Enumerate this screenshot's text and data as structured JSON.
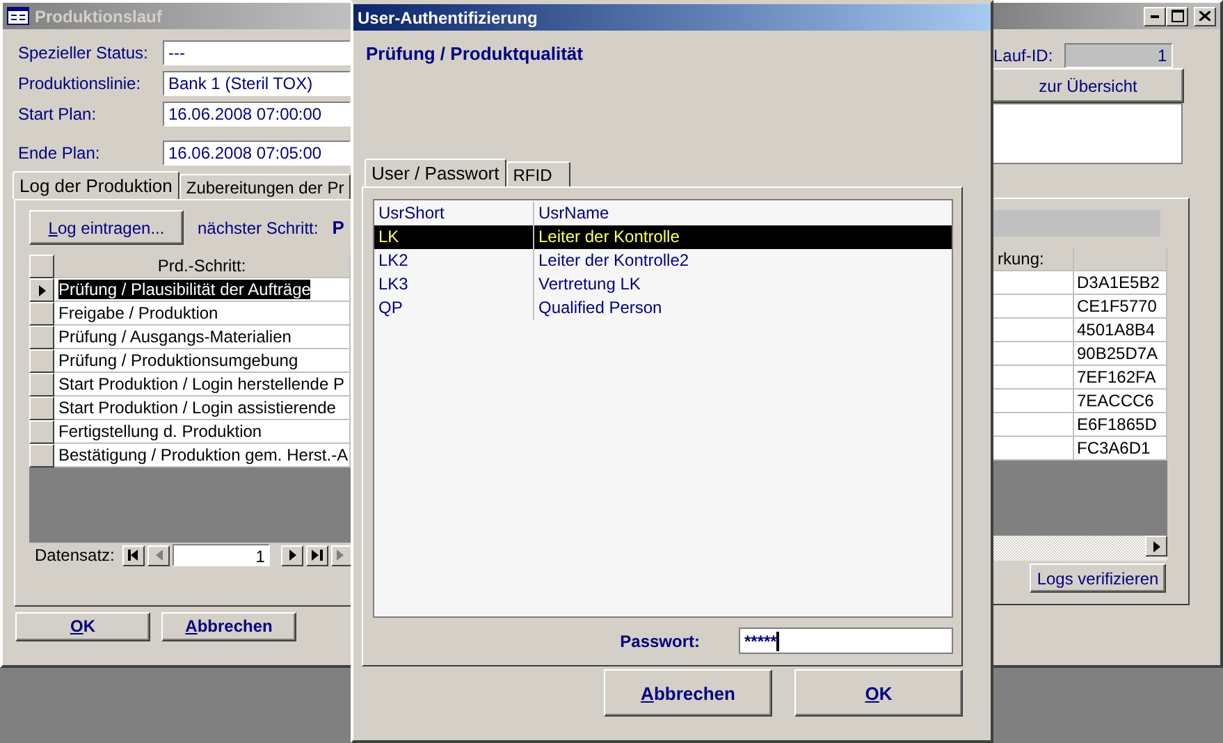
{
  "main_window": {
    "title": "Produktionslauf",
    "fields": [
      {
        "label": "Spezieller Status:",
        "value": "---"
      },
      {
        "label": "Produktionslinie:",
        "value": "Bank 1 (Steril TOX)"
      },
      {
        "label": "Start Plan:",
        "value": "16.06.2008 07:00:00"
      },
      {
        "label": "Ende Plan:",
        "value": "16.06.2008 07:05:00"
      }
    ],
    "lauf_id": {
      "label": "Lauf-ID:",
      "value": "1"
    },
    "overview_button": "zur Übersicht",
    "tabs": [
      {
        "label": "Log der Produktion",
        "selected": true
      },
      {
        "label": "Zubereitungen der Pr",
        "selected": false
      }
    ],
    "log_button": "Log eintragen...",
    "next_step": {
      "label": "nächster Schritt:",
      "value": "P"
    },
    "log_table": {
      "columns": [
        "Prd.-Schritt:",
        "rkung:"
      ],
      "rows": [
        {
          "step": "Prüfung / Plausibilität der Aufträge",
          "column_3": "D3A1E5B2",
          "selected": true
        },
        {
          "step": "Freigabe / Produktion",
          "column_3": "CE1F5770",
          "selected": false
        },
        {
          "step": "Prüfung / Ausgangs-Materialien",
          "column_3": "4501A8B4",
          "selected": false
        },
        {
          "step": "Prüfung / Produktionsumgebung",
          "column_3": "90B25D7A",
          "selected": false
        },
        {
          "step": "Start Produktion / Login herstellende P",
          "column_3": "7EF162FA",
          "selected": false
        },
        {
          "step": "Start Produktion / Login assistierende",
          "column_3": "7EACCC6",
          "selected": false
        },
        {
          "step": "Fertigstellung d. Produktion",
          "column_3": "E6F1865D",
          "selected": false
        },
        {
          "step": "Bestätigung / Produktion gem. Herst.-A",
          "column_3": "FC3A6D1",
          "selected": false
        }
      ]
    },
    "record_nav": {
      "label": "Datensatz:",
      "value": "1"
    },
    "verify_button": "Logs verifizieren",
    "buttons": [
      "OK",
      "Abbrechen"
    ]
  },
  "dialog": {
    "title": "User-Authentifizierung",
    "heading": "Prüfung / Produktqualität",
    "tabs": [
      {
        "label": "User / Passwort",
        "selected": true
      },
      {
        "label": "RFID",
        "selected": false
      }
    ],
    "user_list": {
      "columns": [
        "UsrShort",
        "UsrName"
      ],
      "rows": [
        {
          "short": "LK",
          "name": "Leiter der Kontrolle",
          "selected": true
        },
        {
          "short": "LK2",
          "name": "Leiter der Kontrolle2",
          "selected": false
        },
        {
          "short": "LK3",
          "name": "Vertretung LK",
          "selected": false
        },
        {
          "short": "QP",
          "name": "Qualified Person",
          "selected": false
        }
      ]
    },
    "password": {
      "label": "Passwort:",
      "value": "*****"
    },
    "buttons": [
      "Abbrechen",
      "OK"
    ]
  }
}
